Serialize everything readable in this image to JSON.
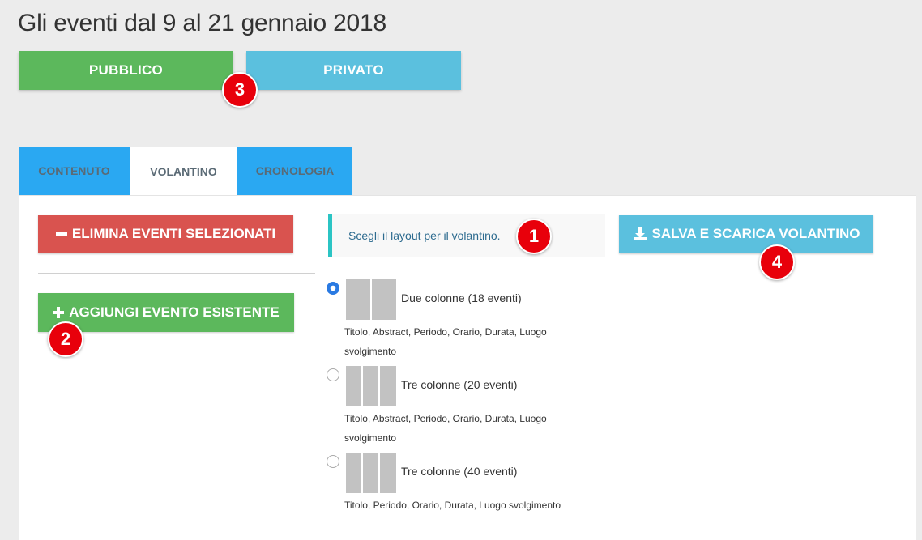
{
  "page": {
    "title": "Gli eventi dal 9 al 21 gennaio 2018"
  },
  "visibility": {
    "public_label": "PUBBLICO",
    "private_label": "PRIVATO"
  },
  "tabs": [
    {
      "label": "CONTENUTO",
      "active": false
    },
    {
      "label": "VOLANTINO",
      "active": true
    },
    {
      "label": "CRONOLOGIA",
      "active": false
    }
  ],
  "actions": {
    "delete_label": "ELIMINA EVENTI SELEZIONATI",
    "delete_icon": "minus-icon",
    "add_label": "AGGIUNGI EVENTO ESISTENTE",
    "add_icon": "plus-icon",
    "save_label": "SALVA E SCARICA VOLANTINO",
    "save_icon": "download-icon"
  },
  "layout_prompt": "Scegli il layout per il volantino.",
  "layouts": [
    {
      "label": "Due colonne (18 eventi)",
      "desc": "Titolo, Abstract, Periodo, Orario, Durata, Luogo svolgimento",
      "columns": 2,
      "selected": true
    },
    {
      "label": "Tre colonne (20 eventi)",
      "desc": "Titolo, Abstract, Periodo, Orario, Durata, Luogo svolgimento",
      "columns": 3,
      "selected": false
    },
    {
      "label": "Tre colonne (40 eventi)",
      "desc": "Titolo, Periodo, Orario, Durata, Luogo svolgimento",
      "columns": 3,
      "selected": false
    }
  ],
  "markers": {
    "m1": "1",
    "m2": "2",
    "m3": "3",
    "m4": "4"
  },
  "colors": {
    "green": "#5cb85c",
    "blue": "#5bc0de",
    "red": "#d9534f",
    "tab_blue": "#2aa8f2",
    "badge_red": "#e8000b"
  }
}
